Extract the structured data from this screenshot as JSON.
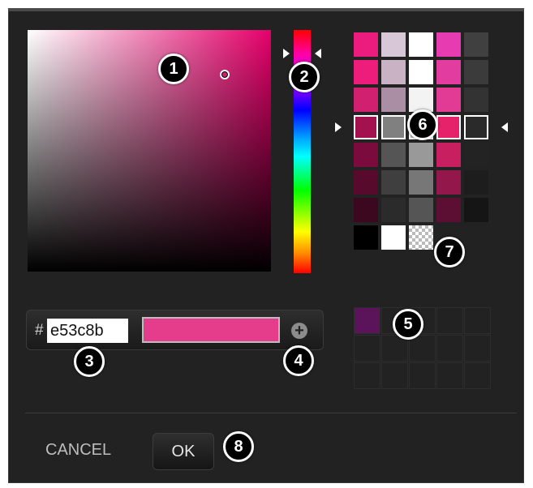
{
  "colors": {
    "current": "#e53c8b",
    "recent_1": "#5b145a"
  },
  "hex_input": {
    "prefix": "#",
    "value": "e53c8b"
  },
  "buttons": {
    "add": "+",
    "cancel": "CANCEL",
    "ok": "OK"
  },
  "callouts": [
    "1",
    "2",
    "3",
    "4",
    "5",
    "6",
    "7",
    "8"
  ],
  "swatches": [
    [
      "#ec1c7f",
      "#d8c7d6",
      "#ffffff",
      "#e73bb2",
      "#404040"
    ],
    [
      "#ee1d7c",
      "#c8b2c4",
      "#ffffff",
      "#e23ca0",
      "#3b3b3b"
    ],
    [
      "#d0206f",
      "#a98ea4",
      "#f3f3f3",
      "#e23b95",
      "#333333"
    ],
    [
      "#a3114e",
      "#808080",
      "#bbbbbb",
      "#e6226b",
      "#2a2a2a"
    ],
    [
      "#7b0b3c",
      "#555555",
      "#999999",
      "#c81f60",
      "#232323"
    ],
    [
      "#580a2c",
      "#3f3f3f",
      "#777777",
      "#93174a",
      "#1d1d1d"
    ],
    [
      "#3c0820",
      "#2b2b2b",
      "#555555",
      "#5c0f32",
      "#151515"
    ],
    [
      "#000000",
      "#ffffff",
      "checkerboard",
      null,
      null
    ]
  ]
}
